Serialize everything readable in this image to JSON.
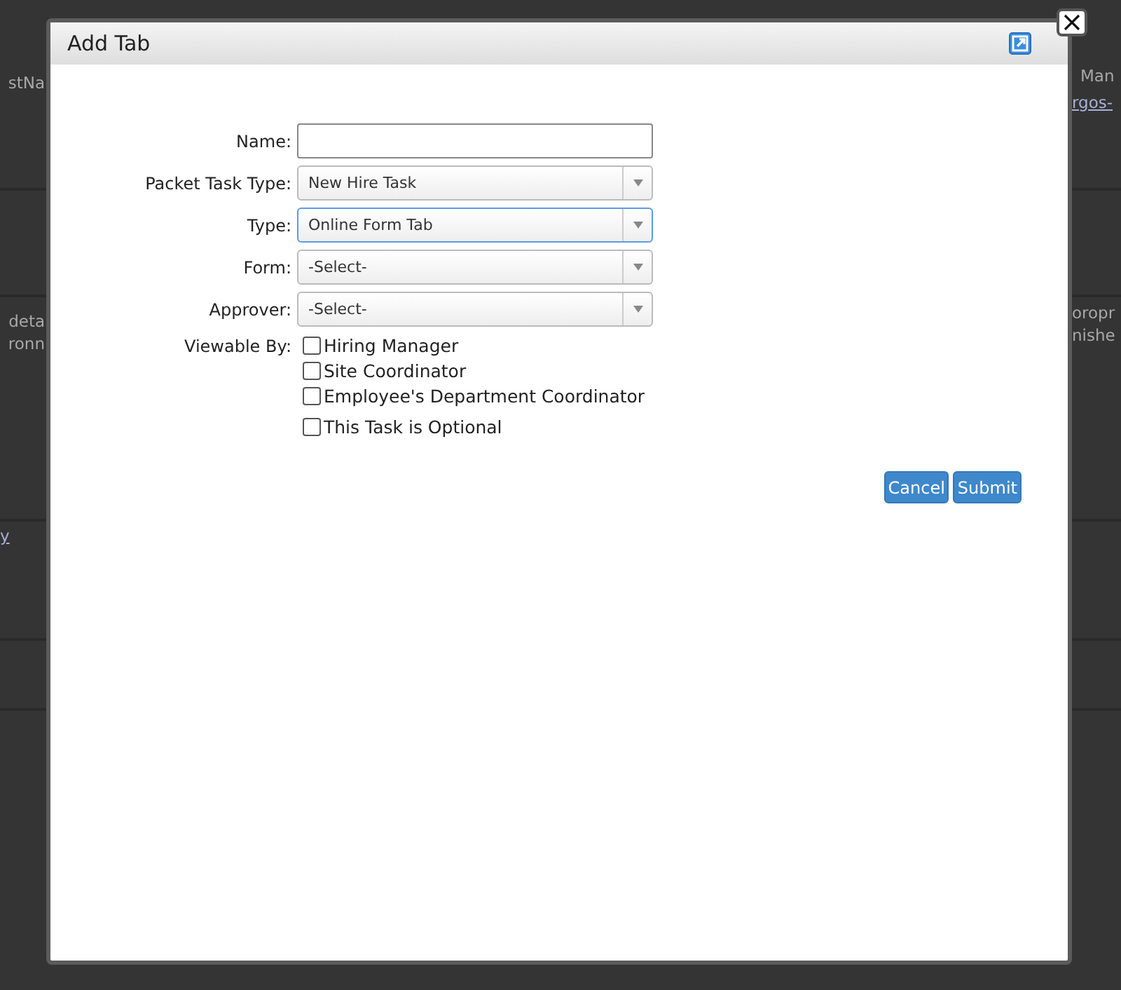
{
  "background": {
    "left": [
      {
        "text": "stNa",
        "kind": "plain"
      },
      {
        "text": "deta",
        "kind": "plain"
      },
      {
        "text": "ronn",
        "kind": "plain"
      },
      {
        "text": "y",
        "kind": "link"
      }
    ],
    "right": [
      {
        "text": "Man",
        "kind": "plain"
      },
      {
        "text": "rgos-",
        "kind": "link"
      },
      {
        "text": "oropr",
        "kind": "plain"
      },
      {
        "text": "nishe",
        "kind": "plain"
      }
    ]
  },
  "dialog": {
    "title": "Add Tab",
    "fields": [
      {
        "label": "Name:",
        "kind": "text",
        "focused": false
      },
      {
        "label": "Packet Task Type:",
        "kind": "select",
        "value": "New Hire Task",
        "focused": false
      },
      {
        "label": "Type:",
        "kind": "select",
        "value": "Online Form Tab",
        "focused": true
      },
      {
        "label": "Form:",
        "kind": "select",
        "value": "-Select-",
        "focused": false
      },
      {
        "label": "Approver:",
        "kind": "select",
        "value": "-Select-",
        "focused": false
      }
    ],
    "viewable_by": {
      "label": "Viewable By:",
      "options": [
        {
          "label": "Hiring Manager",
          "checked": false
        },
        {
          "label": "Site Coordinator",
          "checked": false
        },
        {
          "label": "Employee's Department Coordinator",
          "checked": false
        }
      ]
    },
    "optional": {
      "label": "This Task is Optional",
      "checked": false
    },
    "buttons": [
      "Cancel",
      "Submit"
    ]
  }
}
